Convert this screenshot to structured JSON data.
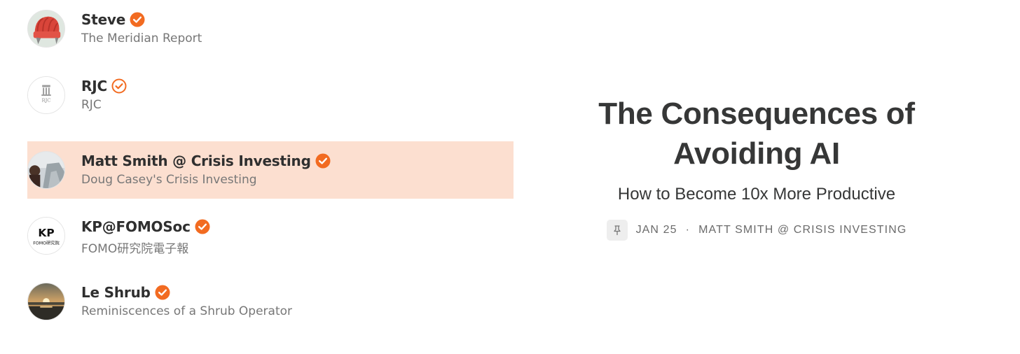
{
  "writers": [
    {
      "name": "Steve",
      "publication": "The Meridian Report",
      "verified": "filled",
      "avatar": "red-beanie-avatar",
      "highlighted": false
    },
    {
      "name": "RJC",
      "publication": "RJC",
      "verified": "outline",
      "avatar": "rjc-logo-avatar",
      "highlighted": false,
      "avatar_text": "RJC"
    },
    {
      "name": "Matt Smith @ Crisis Investing",
      "publication": "Doug Casey's Crisis Investing",
      "verified": "filled",
      "avatar": "photo-avatar",
      "highlighted": true
    },
    {
      "name": "KP@FOMOSoc",
      "publication": "FOMO研究院電子報",
      "verified": "filled",
      "avatar": "kp-logo-avatar",
      "highlighted": false,
      "avatar_text": "KP",
      "avatar_subtext": "FOMO研究院"
    },
    {
      "name": "Le Shrub",
      "publication": "Reminiscences of a Shrub Operator",
      "verified": "filled",
      "avatar": "sunset-avatar",
      "highlighted": false
    }
  ],
  "post": {
    "title": "The Consequences of Avoiding AI",
    "subtitle": "How to Become 10x More Productive",
    "date": "JAN 25",
    "separator": "·",
    "author": "MATT SMITH @ CRISIS INVESTING",
    "pin_icon": "pin-icon"
  },
  "colors": {
    "accent": "#f26b21",
    "highlight_bg": "#fcdfd0",
    "text_primary": "#363737",
    "text_secondary": "#777777"
  }
}
